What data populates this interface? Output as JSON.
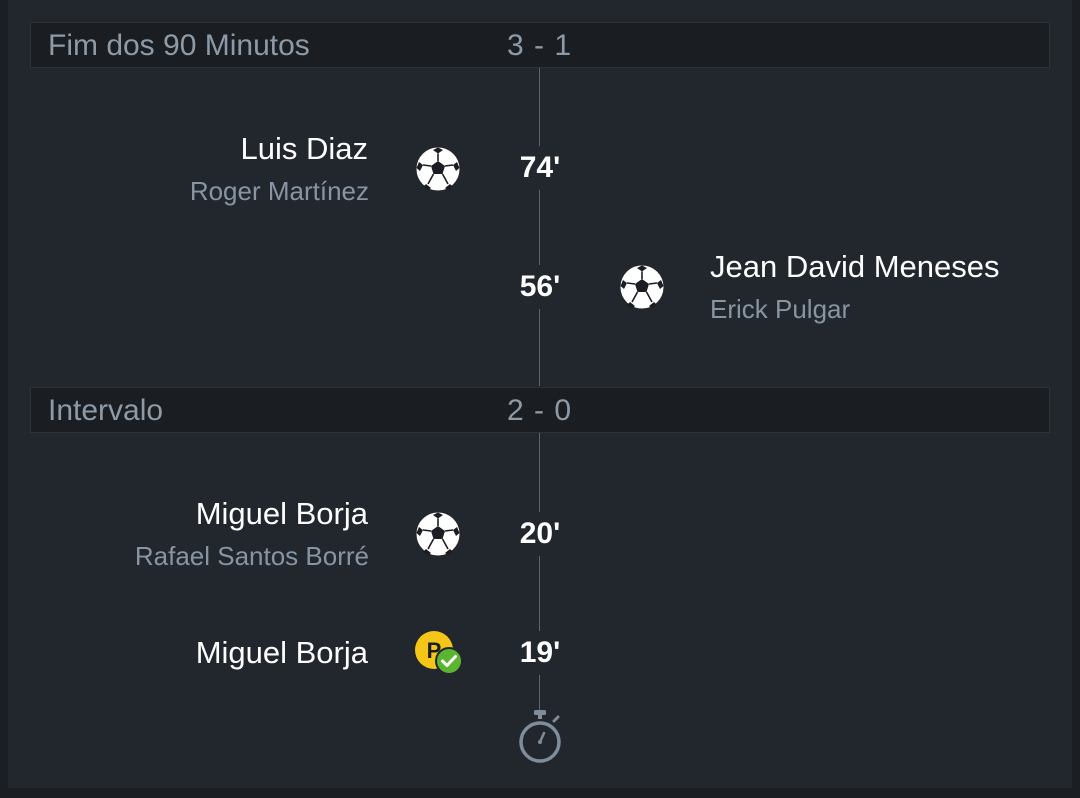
{
  "periods": [
    {
      "label": "Fim dos 90 Minutos",
      "score": "3 - 1",
      "events": [
        {
          "minute": "74'",
          "side": "left",
          "player": "Luis Diaz",
          "assist": "Roger Martínez",
          "icon": "soccer-ball-icon"
        },
        {
          "minute": "56'",
          "side": "right",
          "player": "Jean David Meneses",
          "assist": "Erick Pulgar",
          "icon": "soccer-ball-icon"
        }
      ]
    },
    {
      "label": "Intervalo",
      "score": "2 - 0",
      "events": [
        {
          "minute": "20'",
          "side": "left",
          "player": "Miguel Borja",
          "assist": "Rafael Santos Borré",
          "icon": "soccer-ball-icon"
        },
        {
          "minute": "19'",
          "side": "left",
          "player": "Miguel Borja",
          "assist": "",
          "icon": "penalty-scored-icon"
        }
      ]
    }
  ],
  "colors": {
    "background": "#22272d",
    "header": "#1a1e23",
    "muted_text": "#8e9aa6",
    "penalty_yellow": "#f5c518",
    "penalty_check": "#5cb531"
  },
  "footer_icon": "stopwatch-icon"
}
